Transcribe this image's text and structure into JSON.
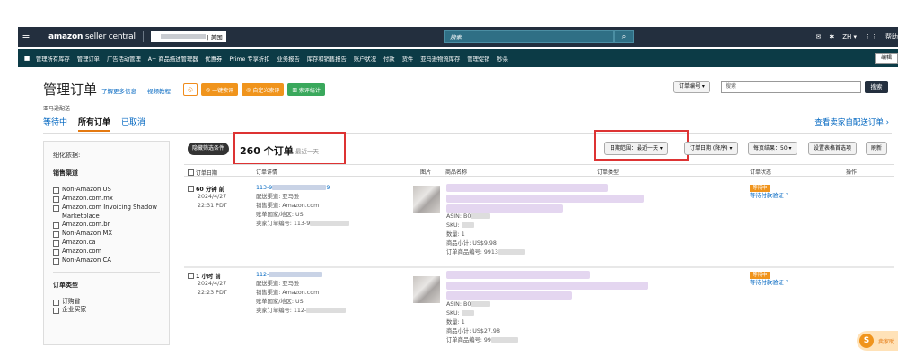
{
  "topbar": {
    "logo_brand": "amazon",
    "logo_text": " seller central",
    "store_suffix": "| 美国",
    "search_placeholder": "搜索",
    "lang": "ZH ▾",
    "help": "帮助"
  },
  "navbar": {
    "items": [
      "管理所有库存",
      "管理订单",
      "广告活动管理",
      "A+ 商品描述管理器",
      "优惠券",
      "Prime 专享折扣",
      "业务报告",
      "库存和销售报告",
      "账户状况",
      "付款",
      "货件",
      "亚马逊物流库存",
      "管理促销",
      "秒杀"
    ],
    "edit": "编辑"
  },
  "header": {
    "title": "管理订单",
    "learn_more": "了解更多信息",
    "video": "视频教程",
    "btn_icon": "⦸",
    "btn1": "一键索评",
    "btn2": "自定义索评",
    "btn3": "索评统计",
    "search_select": "订单编号 ▾",
    "search_placeholder": "搜索",
    "search_btn": "搜索"
  },
  "subloc": "亚马逊配送",
  "tabs": [
    "等待中",
    "所有订单",
    "已取消"
  ],
  "view_all": "查看卖家自配送订单 ›",
  "sidebar": {
    "heading": "细化依据:",
    "channel_title": "销售渠道",
    "channels": [
      "Non-Amazon US",
      "Amazon.com.mx",
      "Amazon.com Invoicing Shadow Marketplace",
      "Amazon.com.br",
      "Non-Amazon MX",
      "Amazon.ca",
      "Amazon.com",
      "Non-Amazon CA"
    ],
    "type_title": "订单类型",
    "types": [
      "订购省",
      "企业买家"
    ]
  },
  "results": {
    "filter_btn": "隐藏筛选条件",
    "count": "260 个订单",
    "count_sub": "最近一天",
    "date_range": "日期范围：最近一天 ▾",
    "sort": "订单日期 (降序) ▾",
    "per_page": "每页结果：50 ▾",
    "settings": "设置表格首选项",
    "refresh": "刷新"
  },
  "columns": [
    "订单日期",
    "订单详情",
    "图片",
    "商品名称",
    "订单类型",
    "订单状态",
    "操作"
  ],
  "orders": [
    {
      "age": "60 分钟 前",
      "date": "2024/4/27",
      "time": "22:31 PDT",
      "order_id": "113-9",
      "order_id_end": "9",
      "channel": "配送渠道: 亚马逊",
      "sales_channel": "销售渠道: Amazon.com",
      "region": "账单国家/地区: US",
      "seller_order": "卖家订单编号: 113-9",
      "asin": "ASIN: B0",
      "sku": "SKU: ",
      "qty": "数量: 1",
      "subtotal": "商品小计: US$9.98",
      "item_id": "订单商品编号: 9913",
      "status": "等待中",
      "status_sub": "等待付款验证 ˅"
    },
    {
      "age": "1 小时 前",
      "date": "2024/4/27",
      "time": "22:23 PDT",
      "order_id": "112-",
      "order_id_end": "",
      "channel": "配送渠道: 亚马逊",
      "sales_channel": "销售渠道: Amazon.com",
      "region": "账单国家/地区: US",
      "seller_order": "卖家订单编号: 112-",
      "asin": "ASIN: B0",
      "sku": "SKU: ",
      "qty": "数量: 1",
      "subtotal": "商品小计: US$27.98",
      "item_id": "订单商品编号: 99",
      "status": "等待中",
      "status_sub": "等待付款验证 ˅"
    }
  ],
  "helper": {
    "icon": "S",
    "label": "卖家助"
  }
}
